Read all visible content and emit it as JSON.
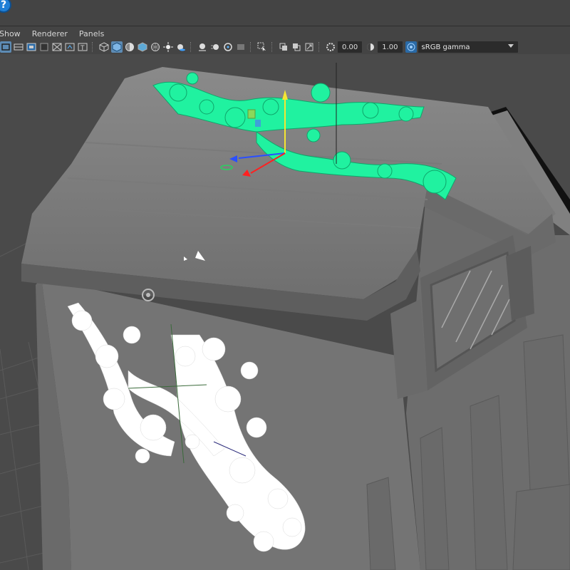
{
  "help": {
    "glyph": "?"
  },
  "menubar": {
    "show": "Show",
    "renderer": "Renderer",
    "panels": "Panels"
  },
  "toolbar": {
    "exposure_value": "0.00",
    "gamma_value": "1.00",
    "colorspace": "sRGB gamma",
    "icons": [
      "select-camera-icon",
      "film-gate-icon",
      "resolution-gate-icon",
      "gate-mask-icon",
      "field-chart-icon",
      "safe-action-icon",
      "safe-title-icon",
      "wireframe-icon",
      "smooth-shade-icon",
      "flat-shade-icon",
      "bounding-box-icon",
      "textured-icon",
      "lighting-icon",
      "shadows-icon",
      "ambient-occlusion-icon",
      "motion-blur-icon",
      "anti-alias-icon",
      "depth-of-field-icon",
      "isolate-select-icon",
      "xray-icon",
      "xray-joints-icon",
      "backface-icon",
      "grid-icon",
      "exposure-icon",
      "gamma-icon",
      "colorspace-icon"
    ]
  },
  "colors": {
    "selected_ivy": "#20f2a0",
    "deselected_ivy": "#ffffff",
    "mesh": "#7d7d7d",
    "grid": "#555555",
    "active_toolbar": "#5d8bb4"
  }
}
